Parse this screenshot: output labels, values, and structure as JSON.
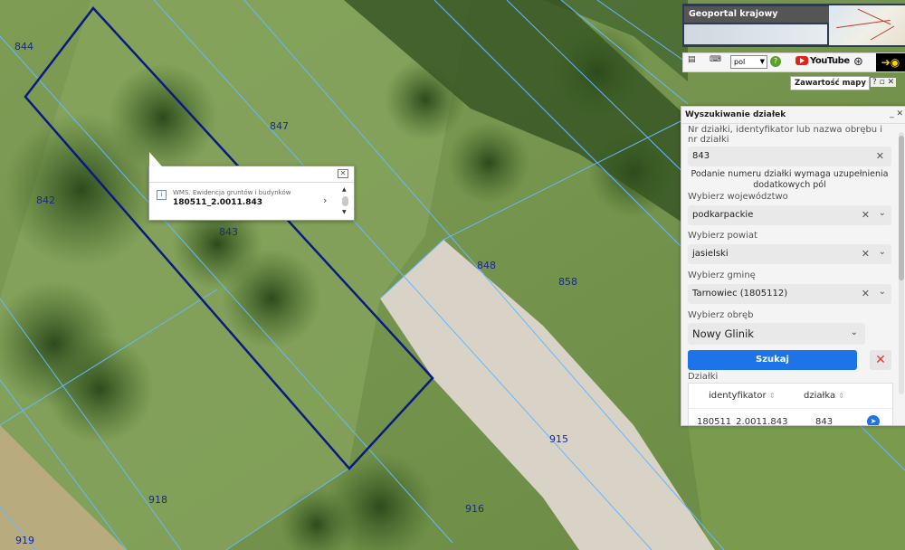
{
  "map": {
    "parcel_labels": [
      {
        "id": "p844",
        "text": "844"
      },
      {
        "id": "p847",
        "text": "847"
      },
      {
        "id": "p842",
        "text": "842"
      },
      {
        "id": "p843",
        "text": "843"
      },
      {
        "id": "p848",
        "text": "848"
      },
      {
        "id": "p858",
        "text": "858"
      },
      {
        "id": "p915",
        "text": "915"
      },
      {
        "id": "p918",
        "text": "918"
      },
      {
        "id": "p916",
        "text": "916"
      },
      {
        "id": "p919",
        "text": "919"
      }
    ],
    "colors": {
      "parcel_line": "#67b7ff",
      "selected_outline": "#0b1a80",
      "label": "#1b2a8a"
    }
  },
  "popup": {
    "source": "WMS. Ewidencja gruntów i budynków",
    "parcel_id": "180511_2.0011.843",
    "close_icon": "close-icon"
  },
  "header": {
    "app_title": "Geoportal krajowy",
    "language": "pol",
    "youtube_label": "YouTube",
    "contents_tab": "Zawartość mapy",
    "contents_controls": "? ▫ ✕"
  },
  "search_panel": {
    "title": "Wyszukiwanie działek",
    "controls": "_ ✕",
    "query_label": "Nr działki, identyfikator lub nazwa obrębu i nr działki",
    "query_value": "843",
    "note": "Podanie numeru działki wymaga uzupełnienia dodatkowych pól",
    "voivodeship_label": "Wybierz województwo",
    "voivodeship_value": "podkarpackie",
    "county_label": "Wybierz powiat",
    "county_value": "jasielski",
    "municipality_label": "Wybierz gminę",
    "municipality_value": "Tarnowiec (1805112)",
    "precinct_label": "Wybierz obręb",
    "precinct_value": "Nowy Glinik",
    "search_button": "Szukaj",
    "results_label": "Działki",
    "results_headers": [
      "identyfikator",
      "działka"
    ],
    "results_rows": [
      {
        "identyfikator": "180511_2.0011.843",
        "dzialka": "843"
      }
    ]
  }
}
